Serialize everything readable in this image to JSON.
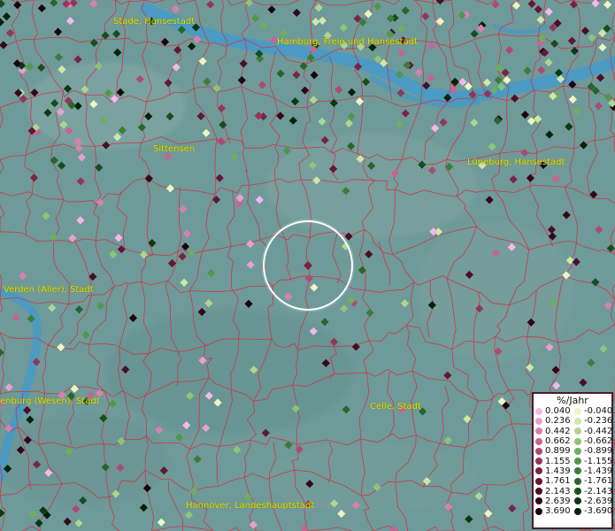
{
  "cities": [
    {
      "name": "Stade, Hansestadt"
    },
    {
      "name": "Hamburg, Freie und Hansestadt"
    },
    {
      "name": "Sittensen"
    },
    {
      "name": "Lüneburg, Hansestadt"
    },
    {
      "name": "Verden (Aller), Stadt"
    },
    {
      "name": "enburg (Wesen), Stadt"
    },
    {
      "name": "Celle, Stadt"
    },
    {
      "name": "Hannover, Landeshauptstadt"
    }
  ],
  "legend": {
    "title": "%/Jahr",
    "positive": [
      {
        "label": "0.040",
        "color": "#f7b6ec"
      },
      {
        "label": "0.236",
        "color": "#e8a0cf"
      },
      {
        "label": "0.442",
        "color": "#d980b0"
      },
      {
        "label": "0.662",
        "color": "#c66591"
      },
      {
        "label": "0.899",
        "color": "#ad4a72"
      },
      {
        "label": "1.155",
        "color": "#933559"
      },
      {
        "label": "1.439",
        "color": "#7a2445"
      },
      {
        "label": "1.761",
        "color": "#621735"
      },
      {
        "label": "2.143",
        "color": "#4a0e26"
      },
      {
        "label": "2.639",
        "color": "#33071a"
      },
      {
        "label": "3.690",
        "color": "#1c020d"
      }
    ],
    "negative": [
      {
        "label": "-0.040",
        "color": "#eef5c0"
      },
      {
        "label": "-0.236",
        "color": "#cfe7a7"
      },
      {
        "label": "-0.442",
        "color": "#afd68e"
      },
      {
        "label": "-0.662",
        "color": "#8fc477"
      },
      {
        "label": "-0.899",
        "color": "#6fae5f"
      },
      {
        "label": "-1.155",
        "color": "#52964a"
      },
      {
        "label": "-1.439",
        "color": "#3a7d39"
      },
      {
        "label": "-1.761",
        "color": "#27652a"
      },
      {
        "label": "-2.143",
        "color": "#174e1d"
      },
      {
        "label": "-2.639",
        "color": "#0b3812"
      },
      {
        "label": "-3.690",
        "color": "#032208"
      }
    ]
  },
  "colors": {
    "background": "#6f9a9a",
    "water": "#3d9ad0",
    "boundaries": "#d8283a",
    "city_label": "#e8e000",
    "focus_ring": "#ffffff"
  }
}
